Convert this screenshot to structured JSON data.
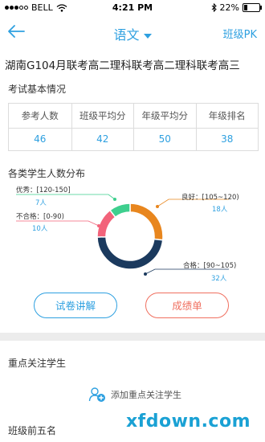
{
  "status_bar": {
    "carrier": "BELL",
    "time": "4:21 PM",
    "battery": "22%",
    "battery_level": 0.22,
    "icons": [
      "wifi-icon",
      "bluetooth-icon",
      "battery-icon"
    ]
  },
  "nav": {
    "back_icon": "arrow-left-icon",
    "subject": "语文",
    "pk_label": "班级PK"
  },
  "exam_title": "湖南G104月联考高二理科联考高二理科联考高三",
  "basic_info": {
    "title": "考试基本情况",
    "headers": [
      "参考人数",
      "班级平均分",
      "年级平均分",
      "年级排名"
    ],
    "values": [
      "46",
      "42",
      "50",
      "38"
    ]
  },
  "distribution": {
    "title": "各类学生人数分布",
    "segments": [
      {
        "label": "良好：[105~120)",
        "count_label": "18人",
        "count": 18,
        "color": "#e8861e"
      },
      {
        "label": "合格：[90~105)",
        "count_label": "32人",
        "count": 32,
        "color": "#1b3a5e"
      },
      {
        "label": "不合格：[0-90)",
        "count_label": "10人",
        "count": 10,
        "color": "#f2637a"
      },
      {
        "label": "优秀：[120-150]",
        "count_label": "7人",
        "count": 7,
        "color": "#3ecf8e"
      }
    ]
  },
  "buttons": {
    "paper_review": "试卷讲解",
    "score_sheet": "成绩单"
  },
  "focus_students": {
    "title": "重点关注学生",
    "add_label": "添加重点关注学生",
    "add_icon": "add-user-icon"
  },
  "top_five": {
    "title": "班级前五名"
  },
  "watermark": "xfdown.com"
}
